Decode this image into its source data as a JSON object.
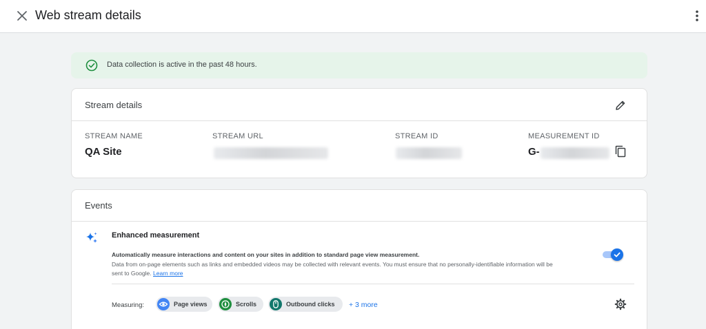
{
  "header": {
    "title": "Web stream details",
    "close_icon": "close-icon",
    "more_icon": "more-vert-icon"
  },
  "banner": {
    "text": "Data collection is active in the past 48 hours.",
    "icon": "check-circle-icon",
    "background": "#e6f4ea",
    "icon_color": "#1e8e3e"
  },
  "stream_details": {
    "title": "Stream details",
    "edit_icon": "edit-pencil-icon",
    "fields": [
      {
        "label": "STREAM NAME",
        "value": "QA Site"
      },
      {
        "label": "STREAM URL",
        "value": ""
      },
      {
        "label": "STREAM ID",
        "value": ""
      },
      {
        "label": "MEASUREMENT ID",
        "value": "G-"
      }
    ],
    "copy_icon": "copy-icon"
  },
  "events": {
    "title": "Events",
    "enhanced": {
      "icon": "sparkle-icon",
      "title": "Enhanced measurement",
      "desc_bold": "Automatically measure interactions and content on your sites in addition to standard page view measurement.",
      "desc": "Data from on-page elements such as links and embedded videos may be collected with relevant events. You must ensure that no personally-identifiable information will be sent to Google.",
      "learn_more": "Learn more",
      "toggle_on": true
    },
    "measuring": {
      "label": "Measuring:",
      "chips": [
        {
          "label": "Page views",
          "icon": "eye-icon",
          "color": "#4285f4"
        },
        {
          "label": "Scrolls",
          "icon": "compass-icon",
          "color": "#1e8e3e"
        },
        {
          "label": "Outbound clicks",
          "icon": "mouse-icon",
          "color": "#12776c"
        }
      ],
      "more": "+ 3 more",
      "settings_icon": "gear-icon"
    }
  },
  "colors": {
    "accent": "#1a73e8",
    "page_background": "#f1f3f4"
  }
}
